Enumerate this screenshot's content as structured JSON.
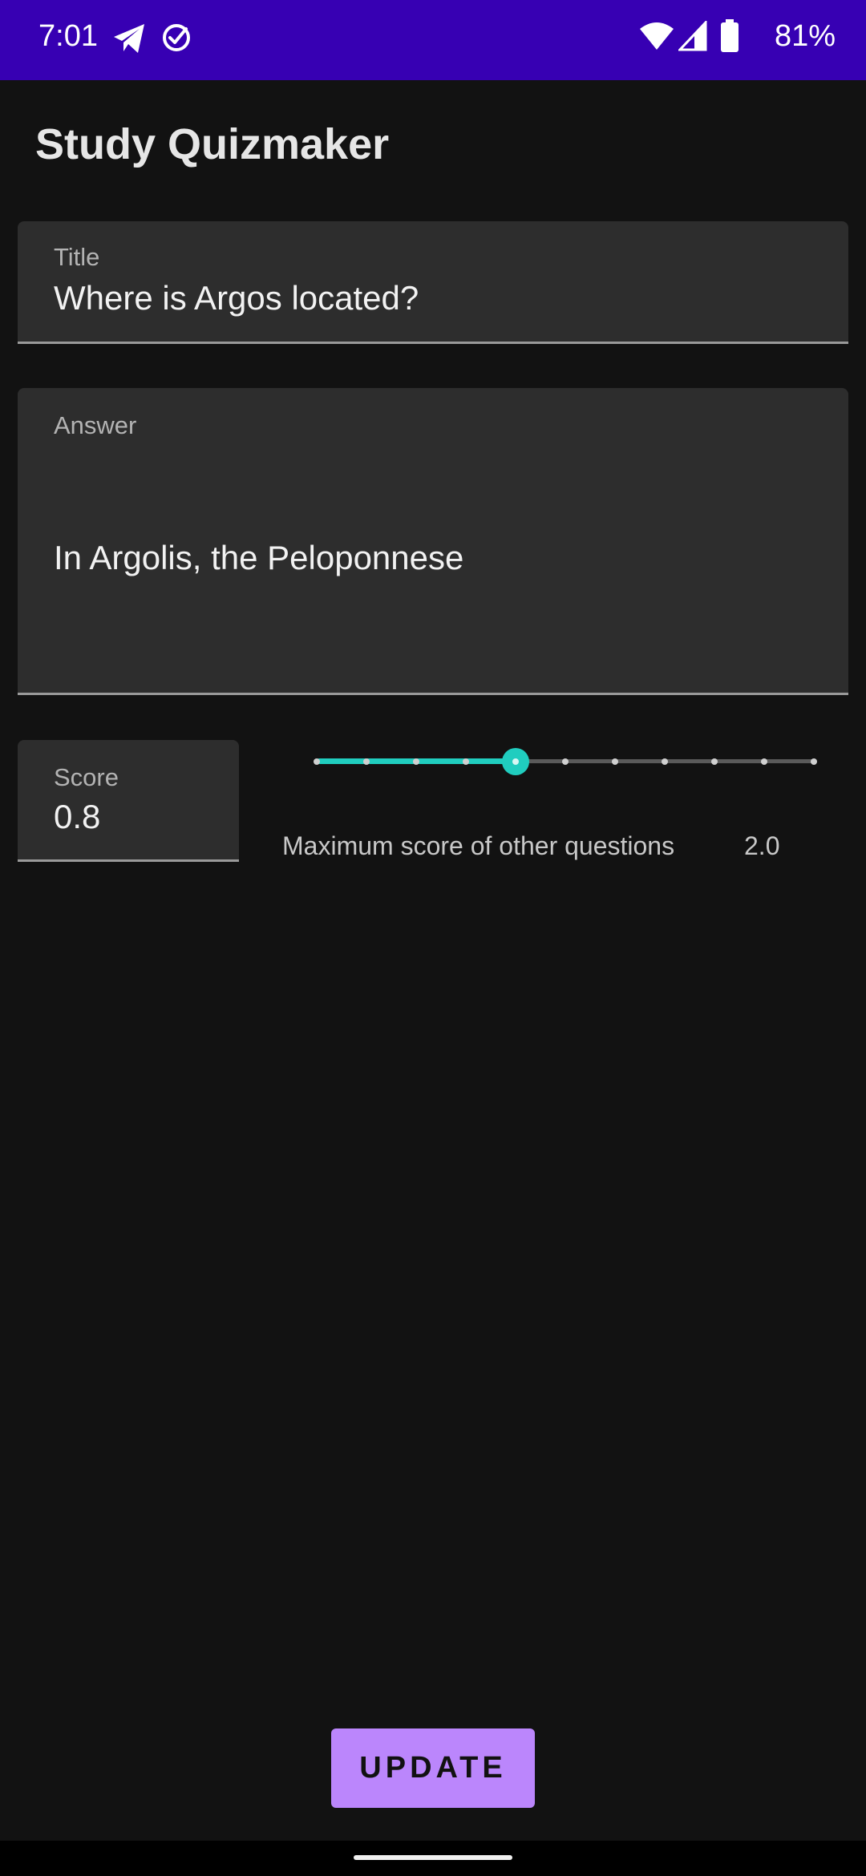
{
  "status_bar": {
    "time": "7:01",
    "battery_percent": "81%",
    "background_color": "#3700b3",
    "icons": [
      "telegram-icon",
      "check-circle-icon",
      "wifi-icon",
      "cellular-signal-icon",
      "battery-icon"
    ]
  },
  "toolbar": {
    "title": "Study Quizmaker"
  },
  "form": {
    "title_field": {
      "label": "Title",
      "value": "Where is Argos located?"
    },
    "answer_field": {
      "label": "Answer",
      "value": "In Argolis, the Peloponnese"
    },
    "score_field": {
      "label": "Score",
      "value": "0.8"
    },
    "score_slider": {
      "min": 0.0,
      "max": 2.0,
      "step": 0.2,
      "value": 0.8,
      "accent_color": "#20cdbf"
    },
    "max_score": {
      "label": "Maximum score of other questions",
      "value": "2.0"
    }
  },
  "actions": {
    "update_label": "UPDATE",
    "button_color": "#bb86fc"
  }
}
